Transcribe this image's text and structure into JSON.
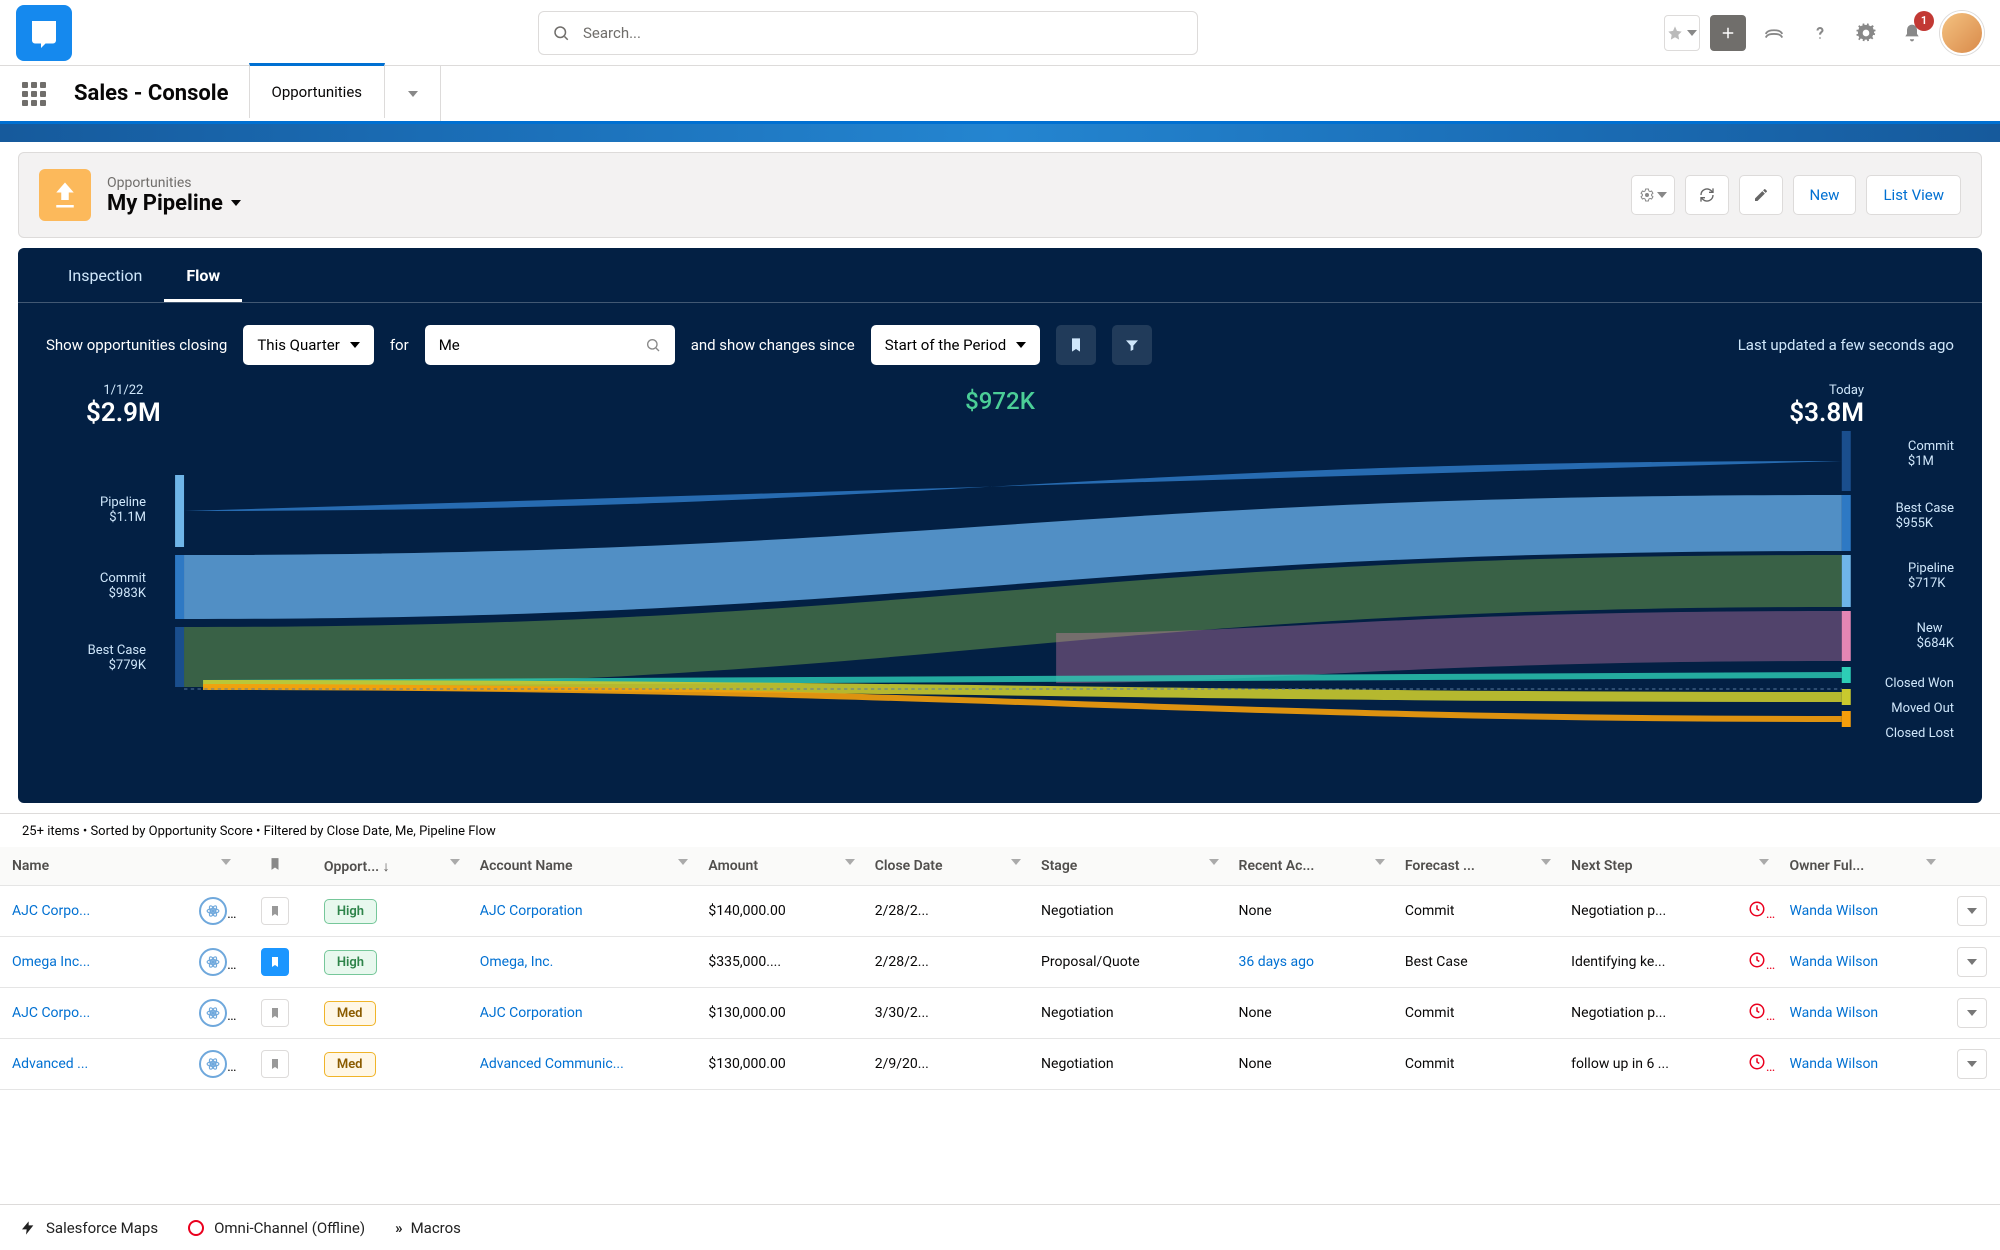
{
  "header": {
    "search_placeholder": "Search...",
    "notif_count": "1",
    "app_name": "Sales - Console",
    "primary_tab": "Opportunities"
  },
  "page": {
    "eyebrow": "Opportunities",
    "title": "My Pipeline",
    "actions": {
      "new": "New",
      "list_view": "List View"
    }
  },
  "tabs": {
    "inspection": "Inspection",
    "flow": "Flow"
  },
  "filter": {
    "label_prefix": "Show opportunities closing",
    "closing": "This Quarter",
    "label_for": "for",
    "who": "Me",
    "label_since": "and show changes since",
    "since": "Start of the Period",
    "updated": "Last updated a few seconds ago"
  },
  "sankey": {
    "delta": "$972K",
    "left_head": {
      "date": "1/1/22",
      "value": "$2.9M"
    },
    "right_head": {
      "date": "Today",
      "value": "$3.8M"
    },
    "left": [
      {
        "name": "Pipeline",
        "amount": "$1.1M"
      },
      {
        "name": "Commit",
        "amount": "$983K"
      },
      {
        "name": "Best Case",
        "amount": "$779K"
      }
    ],
    "right": [
      {
        "name": "Commit",
        "amount": "$1M"
      },
      {
        "name": "Best Case",
        "amount": "$955K"
      },
      {
        "name": "Pipeline",
        "amount": "$717K"
      },
      {
        "name": "New",
        "amount": "$684K"
      },
      {
        "name": "Closed Won",
        "amount": ""
      },
      {
        "name": "Moved Out",
        "amount": ""
      },
      {
        "name": "Closed Lost",
        "amount": ""
      }
    ]
  },
  "chart_data": {
    "type": "sankey",
    "title": "Pipeline flow from period start to today",
    "delta_value": 972000,
    "delta_label": "$972K",
    "from": {
      "date": "1/1/22",
      "total": 2900000,
      "categories": [
        {
          "name": "Pipeline",
          "value": 1100000
        },
        {
          "name": "Commit",
          "value": 983000
        },
        {
          "name": "Best Case",
          "value": 779000
        }
      ]
    },
    "to": {
      "date": "Today",
      "total": 3800000,
      "categories": [
        {
          "name": "Commit",
          "value": 1000000
        },
        {
          "name": "Best Case",
          "value": 955000
        },
        {
          "name": "Pipeline",
          "value": 717000
        },
        {
          "name": "New",
          "value": 684000
        },
        {
          "name": "Closed Won",
          "value": null
        },
        {
          "name": "Moved Out",
          "value": null
        },
        {
          "name": "Closed Lost",
          "value": null
        }
      ]
    }
  },
  "table": {
    "summary": "25+ items • Sorted by Opportunity Score • Filtered by Close Date, Me, Pipeline Flow",
    "headers": {
      "name": "Name",
      "opp": "Opport...",
      "account": "Account Name",
      "amount": "Amount",
      "close": "Close Date",
      "stage": "Stage",
      "recent": "Recent Ac...",
      "forecast": "Forecast ...",
      "next": "Next Step",
      "owner": "Owner Ful..."
    },
    "rows": [
      {
        "name": "AJC Corpo...",
        "score": "High",
        "score_class": "high",
        "account": "AJC Corporation",
        "amount": "$140,000.00",
        "close": "2/28/2...",
        "stage": "Negotiation",
        "recent": "None",
        "recent_link": false,
        "forecast": "Commit",
        "next": "Negotiation p...",
        "owner": "Wanda Wilson",
        "book": false
      },
      {
        "name": "Omega Inc...",
        "score": "High",
        "score_class": "high",
        "account": "Omega, Inc.",
        "amount": "$335,000....",
        "close": "2/28/2...",
        "stage": "Proposal/Quote",
        "recent": "36 days ago",
        "recent_link": true,
        "forecast": "Best Case",
        "next": "Identifying ke...",
        "owner": "Wanda Wilson",
        "book": true
      },
      {
        "name": "AJC Corpo...",
        "score": "Med",
        "score_class": "med",
        "account": "AJC Corporation",
        "amount": "$130,000.00",
        "close": "3/30/2...",
        "stage": "Negotiation",
        "recent": "None",
        "recent_link": false,
        "forecast": "Commit",
        "next": "Negotiation p...",
        "owner": "Wanda Wilson",
        "book": false
      },
      {
        "name": "Advanced ...",
        "score": "Med",
        "score_class": "med",
        "account": "Advanced Communic...",
        "amount": "$130,000.00",
        "close": "2/9/20...",
        "stage": "Negotiation",
        "recent": "None",
        "recent_link": false,
        "forecast": "Commit",
        "next": "follow up in 6 ...",
        "owner": "Wanda Wilson",
        "book": false
      }
    ]
  },
  "util": {
    "maps": "Salesforce Maps",
    "omni": "Omni-Channel (Offline)",
    "macros": "Macros"
  }
}
